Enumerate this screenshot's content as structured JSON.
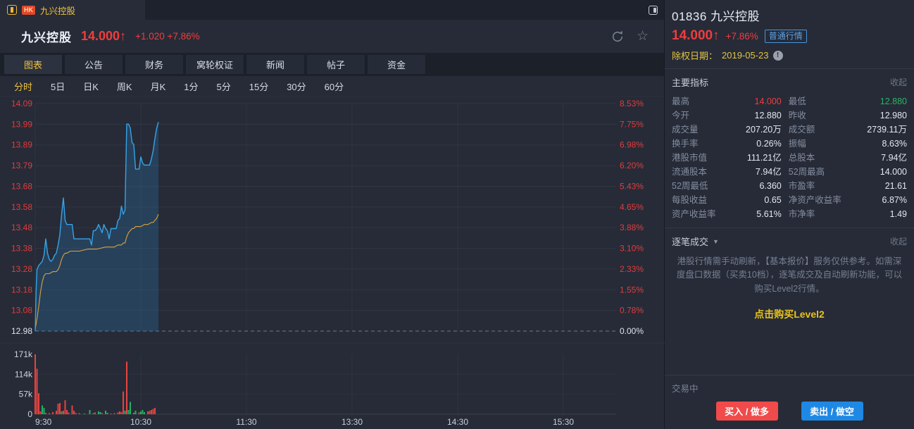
{
  "top_bar": {
    "market_badge": "HK",
    "tab_title": "九兴控股"
  },
  "header": {
    "title": "九兴控股",
    "price": "14.000",
    "arrow": "↑",
    "change": "+1.020",
    "change_pct": "+7.86%",
    "star_icon": "☆"
  },
  "nav_tabs": [
    {
      "label": "图表",
      "active": true
    },
    {
      "label": "公告",
      "active": false
    },
    {
      "label": "财务",
      "active": false
    },
    {
      "label": "窝轮权证",
      "active": false
    },
    {
      "label": "新闻",
      "active": false
    },
    {
      "label": "帖子",
      "active": false
    },
    {
      "label": "资金",
      "active": false
    }
  ],
  "period_tabs": [
    {
      "label": "分时",
      "active": true
    },
    {
      "label": "5日",
      "active": false
    },
    {
      "label": "日K",
      "active": false
    },
    {
      "label": "周K",
      "active": false
    },
    {
      "label": "月K",
      "active": false
    },
    {
      "label": "1分",
      "active": false
    },
    {
      "label": "5分",
      "active": false
    },
    {
      "label": "15分",
      "active": false
    },
    {
      "label": "30分",
      "active": false
    },
    {
      "label": "60分",
      "active": false
    }
  ],
  "chart_data": {
    "type": "line",
    "title": "九兴控股 分时走势",
    "price_axis_labels": [
      "14.09",
      "13.99",
      "13.89",
      "13.79",
      "13.68",
      "13.58",
      "13.48",
      "13.38",
      "13.28",
      "13.18",
      "13.08",
      "12.98"
    ],
    "pct_axis_labels": [
      "8.53%",
      "7.75%",
      "6.98%",
      "6.20%",
      "5.43%",
      "4.65%",
      "3.88%",
      "3.10%",
      "2.33%",
      "1.55%",
      "0.78%",
      "0.00%"
    ],
    "volume_axis_labels": [
      "171k",
      "114k",
      "57k",
      "0"
    ],
    "x_ticks": [
      {
        "label": "9:30",
        "minute": 0
      },
      {
        "label": "10:30",
        "minute": 60
      },
      {
        "label": "11:30",
        "minute": 120
      },
      {
        "label": "13:30",
        "minute": 180
      },
      {
        "label": "14:30",
        "minute": 240
      },
      {
        "label": "15:30",
        "minute": 300
      }
    ],
    "total_minutes": 330,
    "ymin": 12.98,
    "ymax": 14.09,
    "prev_close": 12.98,
    "volume_max_k": 171,
    "colors": {
      "price_line": "#36a3e8",
      "price_fill": "rgba(44,112,168,0.33)",
      "avg_line": "#daa33e",
      "up_bar": "#e8433f",
      "down_bar": "#27b061",
      "axis_red": "#e23c3c",
      "axis_white": "#dfe3ea"
    },
    "series": [
      {
        "name": "price",
        "points": [
          [
            0,
            12.98
          ],
          [
            0.5,
            13.18
          ],
          [
            1,
            13.28
          ],
          [
            2,
            13.3
          ],
          [
            3,
            13.31
          ],
          [
            4,
            13.32
          ],
          [
            5,
            13.35
          ],
          [
            6,
            13.43
          ],
          [
            7,
            13.36
          ],
          [
            8,
            13.33
          ],
          [
            9,
            13.32
          ],
          [
            10,
            13.33
          ],
          [
            11,
            13.35
          ],
          [
            12,
            13.36
          ],
          [
            13,
            13.4
          ],
          [
            14,
            13.45
          ],
          [
            15,
            13.55
          ],
          [
            16,
            13.63
          ],
          [
            17,
            13.52
          ],
          [
            18,
            13.5
          ],
          [
            20,
            13.5
          ],
          [
            21,
            13.5
          ],
          [
            22,
            13.43
          ],
          [
            26,
            13.43
          ],
          [
            30,
            13.43
          ],
          [
            31,
            13.43
          ],
          [
            32,
            13.4
          ],
          [
            33,
            13.47
          ],
          [
            34,
            13.47
          ],
          [
            35,
            13.48
          ],
          [
            36,
            13.5
          ],
          [
            37,
            13.48
          ],
          [
            38,
            13.46
          ],
          [
            39,
            13.5
          ],
          [
            40,
            13.48
          ],
          [
            41,
            13.47
          ],
          [
            42,
            13.43
          ],
          [
            43,
            13.48
          ],
          [
            46,
            13.48
          ],
          [
            47,
            13.52
          ],
          [
            48,
            13.53
          ],
          [
            49,
            13.59
          ],
          [
            50,
            13.55
          ],
          [
            51,
            13.57
          ],
          [
            52,
            13.99
          ],
          [
            53,
            13.99
          ],
          [
            54,
            13.97
          ],
          [
            55,
            13.9
          ],
          [
            56,
            13.89
          ],
          [
            57,
            13.77
          ],
          [
            58,
            13.77
          ],
          [
            59,
            13.77
          ],
          [
            60,
            13.83
          ],
          [
            61,
            13.8
          ],
          [
            62,
            13.79
          ],
          [
            64,
            13.79
          ],
          [
            65,
            13.79
          ],
          [
            66,
            13.82
          ],
          [
            67,
            13.86
          ],
          [
            68,
            13.92
          ],
          [
            69,
            13.97
          ],
          [
            70,
            14.0
          ]
        ]
      },
      {
        "name": "avg",
        "points": [
          [
            0,
            12.99
          ],
          [
            1,
            13.04
          ],
          [
            2,
            13.1
          ],
          [
            3,
            13.17
          ],
          [
            4,
            13.22
          ],
          [
            5,
            13.25
          ],
          [
            6,
            13.26
          ],
          [
            8,
            13.26
          ],
          [
            10,
            13.27
          ],
          [
            12,
            13.27
          ],
          [
            13,
            13.28
          ],
          [
            14,
            13.3
          ],
          [
            15,
            13.33
          ],
          [
            16,
            13.35
          ],
          [
            17,
            13.36
          ],
          [
            18,
            13.36
          ],
          [
            20,
            13.37
          ],
          [
            25,
            13.37
          ],
          [
            30,
            13.38
          ],
          [
            35,
            13.38
          ],
          [
            40,
            13.39
          ],
          [
            45,
            13.39
          ],
          [
            47,
            13.4
          ],
          [
            49,
            13.4
          ],
          [
            50,
            13.41
          ],
          [
            51,
            13.41
          ],
          [
            52,
            13.44
          ],
          [
            53,
            13.46
          ],
          [
            54,
            13.47
          ],
          [
            55,
            13.48
          ],
          [
            56,
            13.48
          ],
          [
            57,
            13.49
          ],
          [
            58,
            13.49
          ],
          [
            60,
            13.49
          ],
          [
            62,
            13.5
          ],
          [
            64,
            13.5
          ],
          [
            66,
            13.51
          ],
          [
            67,
            13.51
          ],
          [
            68,
            13.52
          ],
          [
            69,
            13.53
          ],
          [
            70,
            13.55
          ]
        ]
      }
    ],
    "volume_bars": [
      [
        0,
        171,
        "r"
      ],
      [
        1,
        130,
        "r"
      ],
      [
        2,
        60,
        "r"
      ],
      [
        3,
        8,
        "r"
      ],
      [
        4,
        25,
        "g"
      ],
      [
        5,
        18,
        "g"
      ],
      [
        6,
        4,
        "r"
      ],
      [
        8,
        3,
        "r"
      ],
      [
        10,
        6,
        "r"
      ],
      [
        12,
        10,
        "r"
      ],
      [
        13,
        30,
        "r"
      ],
      [
        14,
        32,
        "r"
      ],
      [
        15,
        8,
        "g"
      ],
      [
        16,
        10,
        "r"
      ],
      [
        17,
        40,
        "r"
      ],
      [
        18,
        12,
        "r"
      ],
      [
        19,
        5,
        "r"
      ],
      [
        21,
        25,
        "r"
      ],
      [
        22,
        10,
        "r"
      ],
      [
        23,
        4,
        "r"
      ],
      [
        25,
        3,
        "r"
      ],
      [
        28,
        2,
        "g"
      ],
      [
        31,
        12,
        "g"
      ],
      [
        33,
        3,
        "g"
      ],
      [
        34,
        5,
        "r"
      ],
      [
        36,
        8,
        "g"
      ],
      [
        37,
        6,
        "g"
      ],
      [
        38,
        3,
        "r"
      ],
      [
        40,
        10,
        "g"
      ],
      [
        41,
        4,
        "g"
      ],
      [
        43,
        2,
        "r"
      ],
      [
        45,
        3,
        "r"
      ],
      [
        47,
        5,
        "r"
      ],
      [
        48,
        8,
        "r"
      ],
      [
        49,
        6,
        "r"
      ],
      [
        50,
        65,
        "r"
      ],
      [
        51,
        10,
        "g"
      ],
      [
        52,
        150,
        "r"
      ],
      [
        53,
        12,
        "g"
      ],
      [
        54,
        35,
        "g"
      ],
      [
        56,
        4,
        "g"
      ],
      [
        57,
        10,
        "g"
      ],
      [
        59,
        5,
        "r"
      ],
      [
        60,
        8,
        "g"
      ],
      [
        61,
        12,
        "g"
      ],
      [
        62,
        6,
        "g"
      ],
      [
        64,
        8,
        "r"
      ],
      [
        65,
        10,
        "r"
      ],
      [
        66,
        12,
        "r"
      ],
      [
        67,
        15,
        "r"
      ],
      [
        68,
        18,
        "r"
      ]
    ]
  },
  "panel": {
    "code_name": "01836 九兴控股",
    "price": "14.000",
    "arrow": "↑",
    "change_pct": "+7.86%",
    "quote_badge": "普通行情",
    "exdate_label": "除权日期：",
    "exdate_value": "2019-05-23",
    "info_icon": "!",
    "indicators": {
      "title": "主要指标",
      "collapse_label": "收起",
      "items": [
        {
          "label": "最高",
          "value": "14.000",
          "color": "red"
        },
        {
          "label": "最低",
          "value": "12.880",
          "color": "green"
        },
        {
          "label": "今开",
          "value": "12.880"
        },
        {
          "label": "昨收",
          "value": "12.980"
        },
        {
          "label": "成交量",
          "value": "207.20万"
        },
        {
          "label": "成交额",
          "value": "2739.11万"
        },
        {
          "label": "换手率",
          "value": "0.26%"
        },
        {
          "label": "振幅",
          "value": "8.63%"
        },
        {
          "label": "港股市值",
          "value": "111.21亿"
        },
        {
          "label": "总股本",
          "value": "7.94亿"
        },
        {
          "label": "流通股本",
          "value": "7.94亿"
        },
        {
          "label": "52周最高",
          "value": "14.000"
        },
        {
          "label": "52周最低",
          "value": "6.360"
        },
        {
          "label": "市盈率",
          "value": "21.61"
        },
        {
          "label": "每股收益",
          "value": "0.65"
        },
        {
          "label": "净资产收益率",
          "value": "6.87%"
        },
        {
          "label": "资产收益率",
          "value": "5.61%"
        },
        {
          "label": "市净率",
          "value": "1.49"
        }
      ]
    },
    "ticks": {
      "title": "逐笔成交",
      "caret": "▼",
      "collapse_label": "收起",
      "note": "港股行情需手动刷新，【基本报价】服务仅供参考。如需深度盘口数据（买卖10档），逐笔成交及自动刷新功能，可以购买Level2行情。",
      "level2_link": "点击购买Level2"
    },
    "trade": {
      "status": "交易中",
      "buy_label": "买入 / 做多",
      "sell_label": "卖出 / 做空"
    }
  }
}
